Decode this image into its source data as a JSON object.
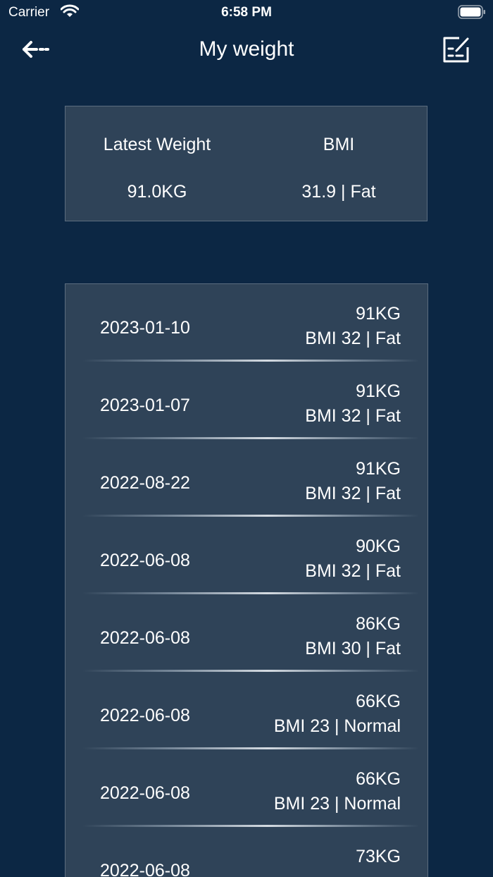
{
  "status_bar": {
    "carrier": "Carrier",
    "time": "6:58 PM"
  },
  "nav": {
    "title": "My weight",
    "back_icon": "back-arrow-icon",
    "edit_icon": "edit-note-icon"
  },
  "summary": {
    "latest_label": "Latest Weight",
    "latest_value": "91.0KG",
    "bmi_label": "BMI",
    "bmi_value": "31.9 | Fat"
  },
  "records": [
    {
      "date": "2023-01-10",
      "weight": "91KG",
      "bmi": "BMI 32 | Fat"
    },
    {
      "date": "2023-01-07",
      "weight": "91KG",
      "bmi": "BMI 32 | Fat"
    },
    {
      "date": "2022-08-22",
      "weight": "91KG",
      "bmi": "BMI 32 | Fat"
    },
    {
      "date": "2022-06-08",
      "weight": "90KG",
      "bmi": "BMI 32 | Fat"
    },
    {
      "date": "2022-06-08",
      "weight": "86KG",
      "bmi": "BMI 30 | Fat"
    },
    {
      "date": "2022-06-08",
      "weight": "66KG",
      "bmi": "BMI 23 | Normal"
    },
    {
      "date": "2022-06-08",
      "weight": "66KG",
      "bmi": "BMI 23 | Normal"
    },
    {
      "date": "2022-06-08",
      "weight": "73KG",
      "bmi": ""
    }
  ],
  "colors": {
    "background": "#0c2744",
    "card": "#2f4358",
    "text": "#ffffff"
  }
}
